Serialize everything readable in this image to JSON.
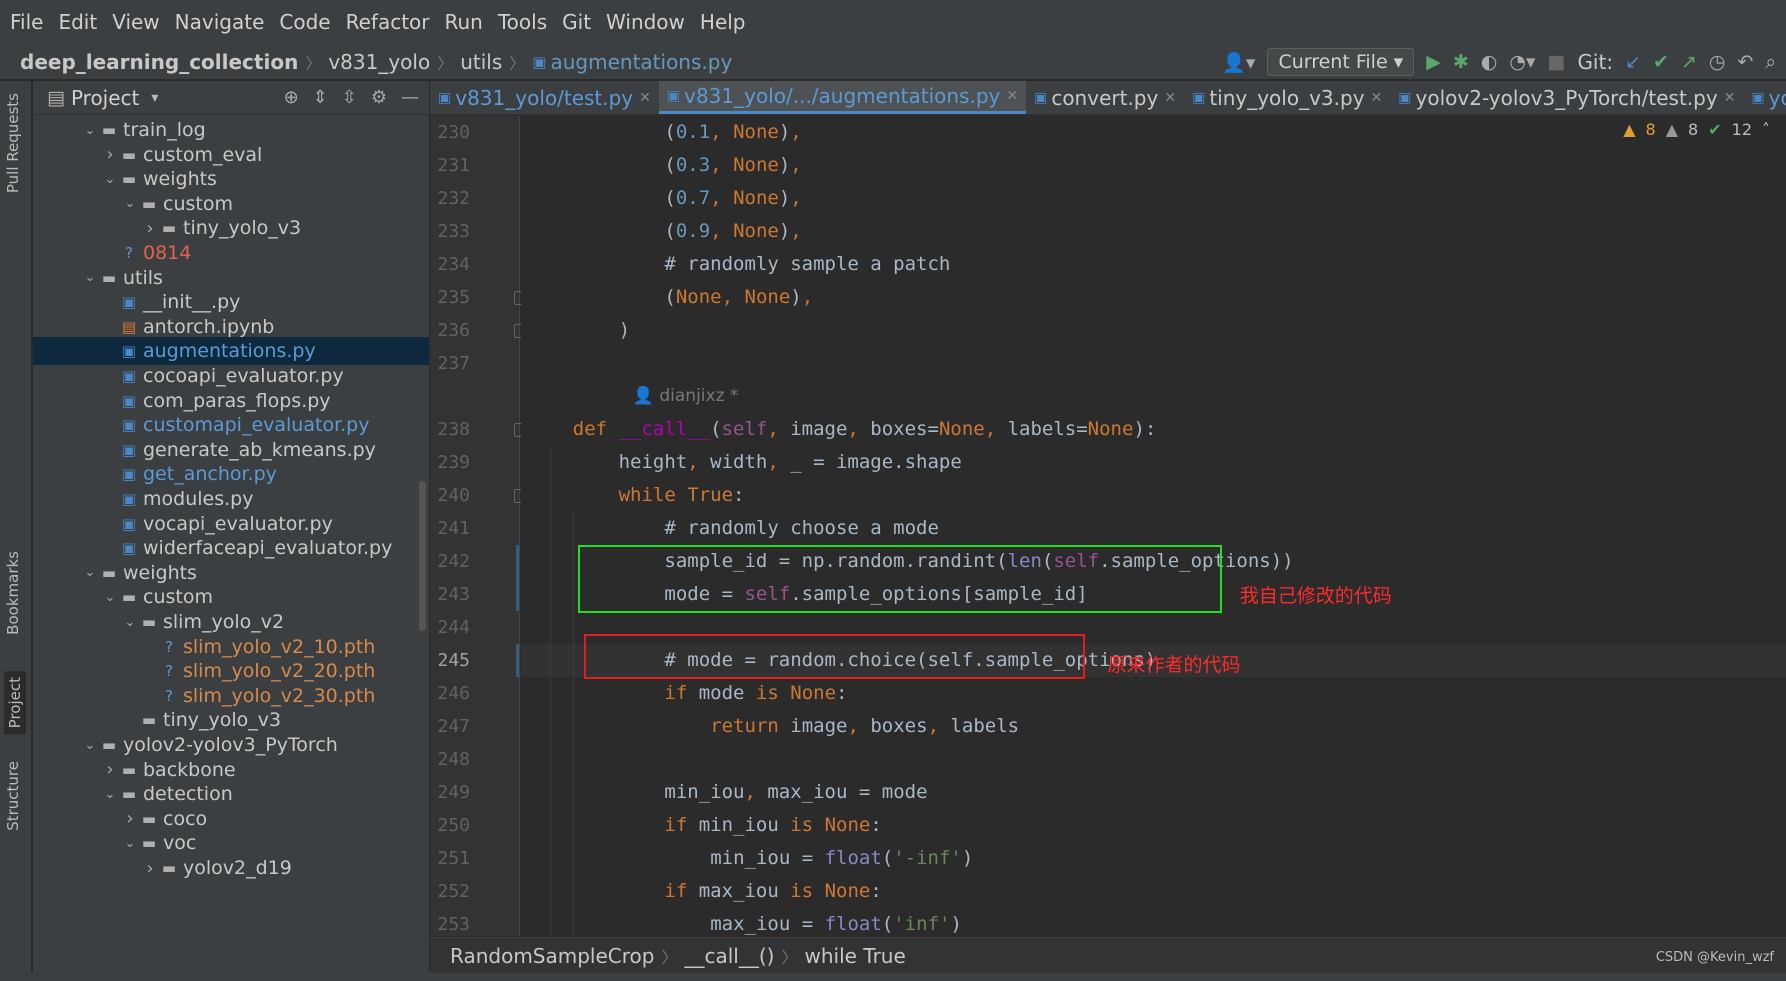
{
  "menu": [
    "File",
    "Edit",
    "View",
    "Navigate",
    "Code",
    "Refactor",
    "Run",
    "Tools",
    "Git",
    "Window",
    "Help"
  ],
  "breadcrumb": {
    "project": "deep_learning_collection",
    "dir1": "v831_yolo",
    "dir2": "utils",
    "file": "augmentations.py"
  },
  "toolbar": {
    "run_config": "Current File",
    "git_label": "Git:"
  },
  "toolstrip": {
    "pull_requests": "Pull Requests",
    "bookmarks": "Bookmarks",
    "project": "Project",
    "structure": "Structure"
  },
  "project_panel": {
    "title": "Project",
    "tree": [
      {
        "label": "train_log",
        "depth": 2,
        "type": "folder",
        "state": "open",
        "color": "default"
      },
      {
        "label": "custom_eval",
        "depth": 3,
        "type": "folder",
        "state": "closed",
        "color": "default"
      },
      {
        "label": "weights",
        "depth": 3,
        "type": "folder",
        "state": "open",
        "color": "default"
      },
      {
        "label": "custom",
        "depth": 4,
        "type": "folder",
        "state": "open",
        "color": "default"
      },
      {
        "label": "tiny_yolo_v3",
        "depth": 5,
        "type": "folder",
        "state": "closed",
        "color": "default"
      },
      {
        "label": "0814",
        "depth": 3,
        "type": "file-unknown",
        "state": "",
        "color": "red"
      },
      {
        "label": "utils",
        "depth": 2,
        "type": "folder",
        "state": "open",
        "color": "default"
      },
      {
        "label": "__init__.py",
        "depth": 3,
        "type": "py",
        "state": "",
        "color": "default"
      },
      {
        "label": "antorch.ipynb",
        "depth": 3,
        "type": "ipynb",
        "state": "",
        "color": "default"
      },
      {
        "label": "augmentations.py",
        "depth": 3,
        "type": "py",
        "state": "",
        "color": "blue",
        "selected": true
      },
      {
        "label": "cocoapi_evaluator.py",
        "depth": 3,
        "type": "py",
        "state": "",
        "color": "default"
      },
      {
        "label": "com_paras_flops.py",
        "depth": 3,
        "type": "py",
        "state": "",
        "color": "default"
      },
      {
        "label": "customapi_evaluator.py",
        "depth": 3,
        "type": "py",
        "state": "",
        "color": "blue"
      },
      {
        "label": "generate_ab_kmeans.py",
        "depth": 3,
        "type": "py",
        "state": "",
        "color": "default"
      },
      {
        "label": "get_anchor.py",
        "depth": 3,
        "type": "py",
        "state": "",
        "color": "blue"
      },
      {
        "label": "modules.py",
        "depth": 3,
        "type": "py",
        "state": "",
        "color": "default"
      },
      {
        "label": "vocapi_evaluator.py",
        "depth": 3,
        "type": "py",
        "state": "",
        "color": "default"
      },
      {
        "label": "widerfaceapi_evaluator.py",
        "depth": 3,
        "type": "py",
        "state": "",
        "color": "default"
      },
      {
        "label": "weights",
        "depth": 2,
        "type": "folder",
        "state": "open",
        "color": "default"
      },
      {
        "label": "custom",
        "depth": 3,
        "type": "folder",
        "state": "open",
        "color": "default"
      },
      {
        "label": "slim_yolo_v2",
        "depth": 4,
        "type": "folder",
        "state": "open",
        "color": "default"
      },
      {
        "label": "slim_yolo_v2_10.pth",
        "depth": 5,
        "type": "file-unknown",
        "state": "",
        "color": "orange"
      },
      {
        "label": "slim_yolo_v2_20.pth",
        "depth": 5,
        "type": "file-unknown",
        "state": "",
        "color": "orange"
      },
      {
        "label": "slim_yolo_v2_30.pth",
        "depth": 5,
        "type": "file-unknown",
        "state": "",
        "color": "orange"
      },
      {
        "label": "tiny_yolo_v3",
        "depth": 4,
        "type": "folder",
        "state": "none",
        "color": "default"
      },
      {
        "label": "yolov2-yolov3_PyTorch",
        "depth": 2,
        "type": "folder",
        "state": "open",
        "color": "default"
      },
      {
        "label": "backbone",
        "depth": 3,
        "type": "folder",
        "state": "closed",
        "color": "default"
      },
      {
        "label": "detection",
        "depth": 3,
        "type": "folder",
        "state": "open",
        "color": "default"
      },
      {
        "label": "coco",
        "depth": 4,
        "type": "folder",
        "state": "closed",
        "color": "default"
      },
      {
        "label": "voc",
        "depth": 4,
        "type": "folder",
        "state": "open",
        "color": "default"
      },
      {
        "label": "yolov2_d19",
        "depth": 5,
        "type": "folder",
        "state": "closed",
        "color": "default"
      }
    ]
  },
  "tabs": [
    {
      "label": "v831_yolo/test.py",
      "active": false,
      "color": "blue"
    },
    {
      "label": "v831_yolo/.../augmentations.py",
      "active": true,
      "color": "blue"
    },
    {
      "label": "convert.py",
      "active": false,
      "color": "default"
    },
    {
      "label": "tiny_yolo_v3.py",
      "active": false,
      "color": "default"
    },
    {
      "label": "yolov2-yolov3_PyTorch/test.py",
      "active": false,
      "color": "default"
    },
    {
      "label": "yolo",
      "active": false,
      "color": "blue"
    }
  ],
  "inspection": {
    "warnings1": "8",
    "warnings2": "8",
    "ok": "12"
  },
  "editor": {
    "author_hint": "dianjixz *",
    "current_line": "245",
    "lines": [
      {
        "n": "230",
        "code": "(0.1, None),"
      },
      {
        "n": "231",
        "code": "(0.3, None),"
      },
      {
        "n": "232",
        "code": "(0.7, None),"
      },
      {
        "n": "233",
        "code": "(0.9, None),"
      },
      {
        "n": "234",
        "code": "# randomly sample a patch"
      },
      {
        "n": "235",
        "code": "(None, None),"
      },
      {
        "n": "236",
        "code": ")"
      },
      {
        "n": "237",
        "code": ""
      },
      {
        "n": "238",
        "code": "def __call__(self, image, boxes=None, labels=None):"
      },
      {
        "n": "239",
        "code": "height, width, _ = image.shape"
      },
      {
        "n": "240",
        "code": "while True:"
      },
      {
        "n": "241",
        "code": "# randomly choose a mode"
      },
      {
        "n": "242",
        "code": "sample_id = np.random.randint(len(self.sample_options))"
      },
      {
        "n": "243",
        "code": "mode = self.sample_options[sample_id]"
      },
      {
        "n": "244",
        "code": ""
      },
      {
        "n": "245",
        "code": "# mode = random.choice(self.sample_options)"
      },
      {
        "n": "246",
        "code": "if mode is None:"
      },
      {
        "n": "247",
        "code": "return image, boxes, labels"
      },
      {
        "n": "248",
        "code": ""
      },
      {
        "n": "249",
        "code": "min_iou, max_iou = mode"
      },
      {
        "n": "250",
        "code": "if min_iou is None:"
      },
      {
        "n": "251",
        "code": "min_iou = float('-inf')"
      },
      {
        "n": "252",
        "code": "if max_iou is None:"
      },
      {
        "n": "253",
        "code": "max_iou = float('inf')"
      }
    ]
  },
  "annotations": {
    "green_label": "我自己修改的代码",
    "red_label": "原来作者的代码"
  },
  "status_breadcrumb": [
    "RandomSampleCrop",
    "__call__()",
    "while True"
  ],
  "watermark": "CSDN @Kevin_wzf",
  "colors": {
    "accent": "#4a88c7",
    "green_box": "#22dd22",
    "red_box": "#e02020"
  }
}
